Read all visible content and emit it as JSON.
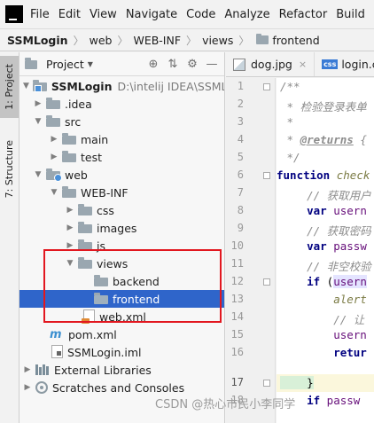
{
  "menubar": {
    "items": [
      "File",
      "Edit",
      "View",
      "Navigate",
      "Code",
      "Analyze",
      "Refactor",
      "Build",
      "Ru"
    ]
  },
  "breadcrumb": {
    "items": [
      "SSMLogin",
      "web",
      "WEB-INF",
      "views",
      "frontend"
    ]
  },
  "toolstrip": {
    "project_tab": "1: Project",
    "structure_tab": "7: Structure"
  },
  "project_panel": {
    "title": "Project",
    "tree": [
      {
        "label": "SSMLogin",
        "path": "D:\\intelij IDEA\\SSMLog"
      },
      {
        "label": ".idea"
      },
      {
        "label": "src"
      },
      {
        "label": "main"
      },
      {
        "label": "test"
      },
      {
        "label": "web"
      },
      {
        "label": "WEB-INF"
      },
      {
        "label": "css"
      },
      {
        "label": "images"
      },
      {
        "label": "js"
      },
      {
        "label": "views"
      },
      {
        "label": "backend"
      },
      {
        "label": "frontend"
      },
      {
        "label": "web.xml"
      },
      {
        "label": "pom.xml"
      },
      {
        "label": "SSMLogin.iml"
      },
      {
        "label": "External Libraries"
      },
      {
        "label": "Scratches and Consoles"
      }
    ]
  },
  "editor": {
    "tabs": [
      {
        "name": "dog.jpg",
        "close": "×"
      },
      {
        "name": "login.cs",
        "badge": "css"
      }
    ],
    "line_numbers": [
      "1",
      "2",
      "3",
      "4",
      "5",
      "6",
      "7",
      "8",
      "9",
      "10",
      "11",
      "12",
      "13",
      "14",
      "15",
      "16",
      "17",
      "18"
    ],
    "code": {
      "l1": "/**",
      "l2": " * 检验登录表单",
      "l3": " *",
      "l4_a": " * ",
      "l4_b": "@returns",
      "l4_c": " {",
      "l5": " */",
      "l6_kw": "function",
      "l6_fn": " check",
      "l7": "    // 获取用户",
      "l8_kw": "    var",
      "l8_v": " usern",
      "l9": "    // 获取密码",
      "l10_kw": "    var",
      "l10_v": " passw",
      "l11": "    // 非空校验",
      "l12_kw": "    if",
      "l12_p": " (",
      "l12_v": "usern",
      "l13": "        alert",
      "l14": "        // 让",
      "l15": "        usern",
      "l16": "        retur",
      "l17": "    }",
      "l18_kw": "    if",
      "l18_v": " passw"
    }
  },
  "watermark": "CSDN @热心市民小李同学"
}
